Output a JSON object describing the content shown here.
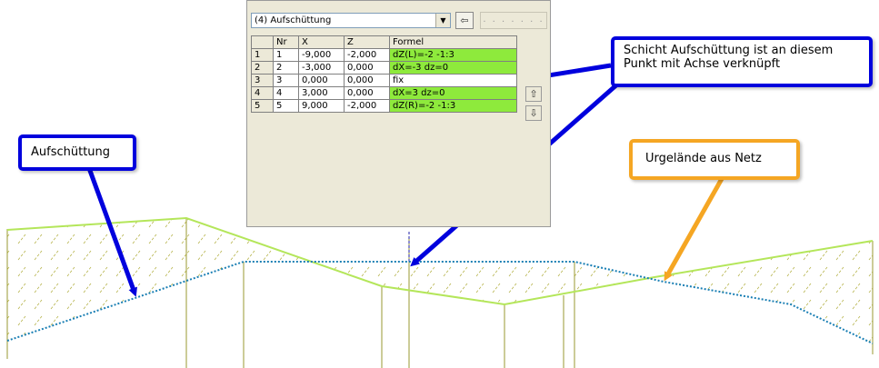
{
  "colors": {
    "blue": "#0000dd",
    "orange": "#f5a623",
    "green_cell": "#8eea3c",
    "terrain_line": "#b4e65a",
    "layer_line": "#1a7fb4",
    "vertical_line": "#9a9a30"
  },
  "dialog": {
    "combo_value": "(4) Aufschüttung",
    "tool_icon": "pin-icon",
    "dots_label": ". . . . . . .",
    "columns": [
      "",
      "Nr",
      "X",
      "Z",
      "Formel"
    ],
    "rows": [
      {
        "idx": "1",
        "nr": "1",
        "x": "-9,000",
        "z": "-2,000",
        "formel": "dZ(L)=-2 -1:3",
        "highlight": true
      },
      {
        "idx": "2",
        "nr": "2",
        "x": "-3,000",
        "z": "0,000",
        "formel": "dX=-3 dz=0",
        "highlight": true
      },
      {
        "idx": "3",
        "nr": "3",
        "x": "0,000",
        "z": "0,000",
        "formel": "fix",
        "highlight": false
      },
      {
        "idx": "4",
        "nr": "4",
        "x": "3,000",
        "z": "0,000",
        "formel": "dX=3 dz=0",
        "highlight": true
      },
      {
        "idx": "5",
        "nr": "5",
        "x": "9,000",
        "z": "-2,000",
        "formel": "dZ(R)=-2 -1:3",
        "highlight": true
      }
    ],
    "up_icon": "arrow-up-icon",
    "down_icon": "arrow-down-icon"
  },
  "callouts": {
    "link": {
      "line1": "Schicht Aufschüttung ist an diesem",
      "line2": "Punkt mit Achse verknüpft"
    },
    "fill": {
      "text": "Aufschüttung"
    },
    "terrain": {
      "text": "Urgelände aus Netz"
    }
  }
}
